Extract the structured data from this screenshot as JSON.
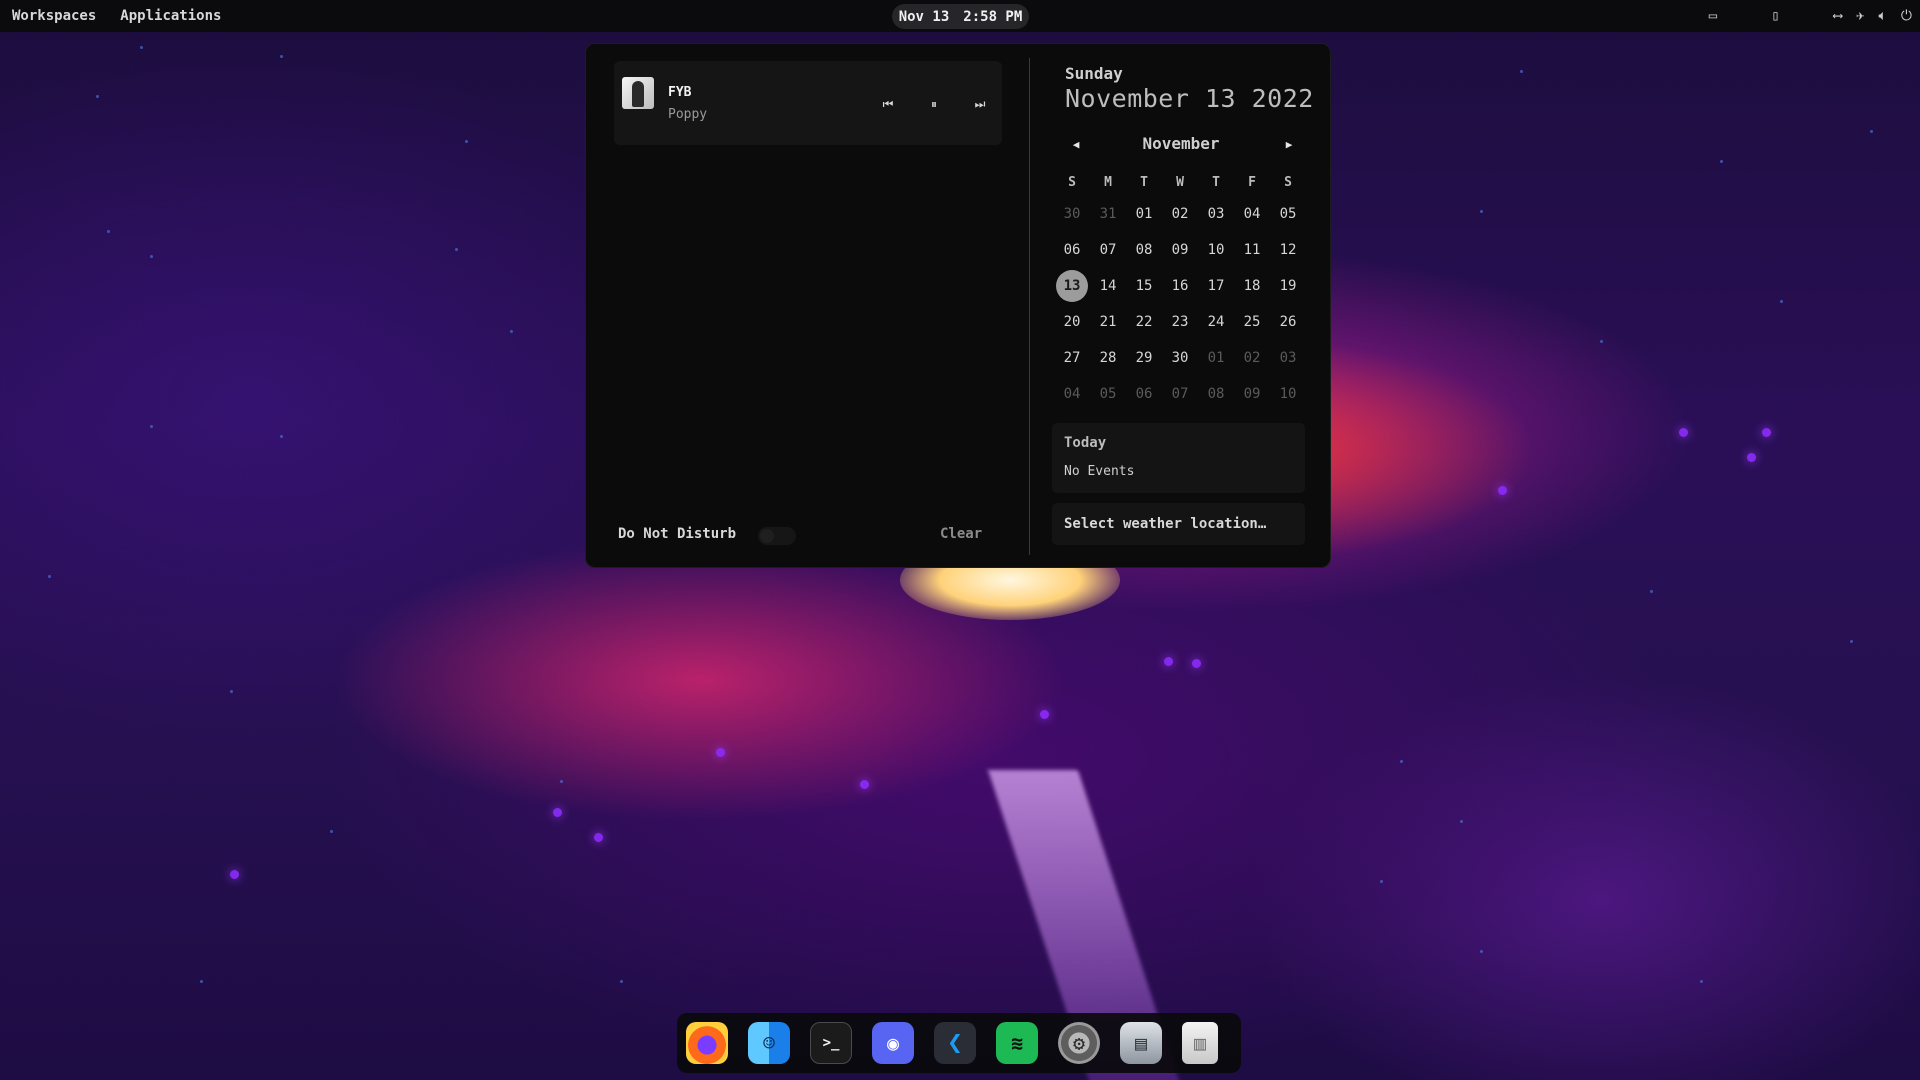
{
  "topbar": {
    "workspaces_label": "Workspaces",
    "applications_label": "Applications",
    "clock_date": "Nov 13",
    "clock_time": "2:58 PM",
    "tray_icons": [
      "display-icon",
      "clipboard-icon",
      "network-icon",
      "airplane-icon",
      "volume-icon",
      "power-icon"
    ]
  },
  "media": {
    "title": "FYB",
    "artist": "Poppy",
    "prev_symbol": "⏮",
    "pause_symbol": "⏸",
    "next_symbol": "⏭"
  },
  "notifications": {
    "dnd_label": "Do Not Disturb",
    "dnd_enabled": false,
    "clear_label": "Clear"
  },
  "calendar": {
    "day_name": "Sunday",
    "full_date": "November 13 2022",
    "month": "November",
    "weekdays": [
      "S",
      "M",
      "T",
      "W",
      "T",
      "F",
      "S"
    ],
    "days": [
      {
        "d": "30",
        "muted": true
      },
      {
        "d": "31",
        "muted": true
      },
      {
        "d": "01"
      },
      {
        "d": "02"
      },
      {
        "d": "03"
      },
      {
        "d": "04"
      },
      {
        "d": "05"
      },
      {
        "d": "06"
      },
      {
        "d": "07"
      },
      {
        "d": "08"
      },
      {
        "d": "09"
      },
      {
        "d": "10"
      },
      {
        "d": "11"
      },
      {
        "d": "12"
      },
      {
        "d": "13",
        "today": true
      },
      {
        "d": "14"
      },
      {
        "d": "15"
      },
      {
        "d": "16"
      },
      {
        "d": "17"
      },
      {
        "d": "18"
      },
      {
        "d": "19"
      },
      {
        "d": "20"
      },
      {
        "d": "21"
      },
      {
        "d": "22"
      },
      {
        "d": "23"
      },
      {
        "d": "24"
      },
      {
        "d": "25"
      },
      {
        "d": "26"
      },
      {
        "d": "27"
      },
      {
        "d": "28"
      },
      {
        "d": "29"
      },
      {
        "d": "30"
      },
      {
        "d": "01",
        "muted": true
      },
      {
        "d": "02",
        "muted": true
      },
      {
        "d": "03",
        "muted": true
      },
      {
        "d": "04",
        "muted": true
      },
      {
        "d": "05",
        "muted": true
      },
      {
        "d": "06",
        "muted": true
      },
      {
        "d": "07",
        "muted": true
      },
      {
        "d": "08",
        "muted": true
      },
      {
        "d": "09",
        "muted": true
      },
      {
        "d": "10",
        "muted": true
      }
    ]
  },
  "events": {
    "title": "Today",
    "empty_text": "No Events"
  },
  "weather": {
    "prompt": "Select weather location…"
  },
  "dock": {
    "apps": [
      {
        "name": "firefox",
        "glyph": ""
      },
      {
        "name": "finder",
        "glyph": "☺"
      },
      {
        "name": "terminal",
        "glyph": ">_"
      },
      {
        "name": "discord",
        "glyph": "◉"
      },
      {
        "name": "vscode",
        "glyph": "❮"
      },
      {
        "name": "spotify",
        "glyph": "≋"
      },
      {
        "name": "settings",
        "glyph": "⚙"
      },
      {
        "name": "disk",
        "glyph": "▤"
      },
      {
        "name": "trash",
        "glyph": "▥"
      }
    ]
  },
  "colors": {
    "popup_bg": "#0b0b0b",
    "card_bg": "#151515",
    "today_circle": "#9c9c9c"
  }
}
